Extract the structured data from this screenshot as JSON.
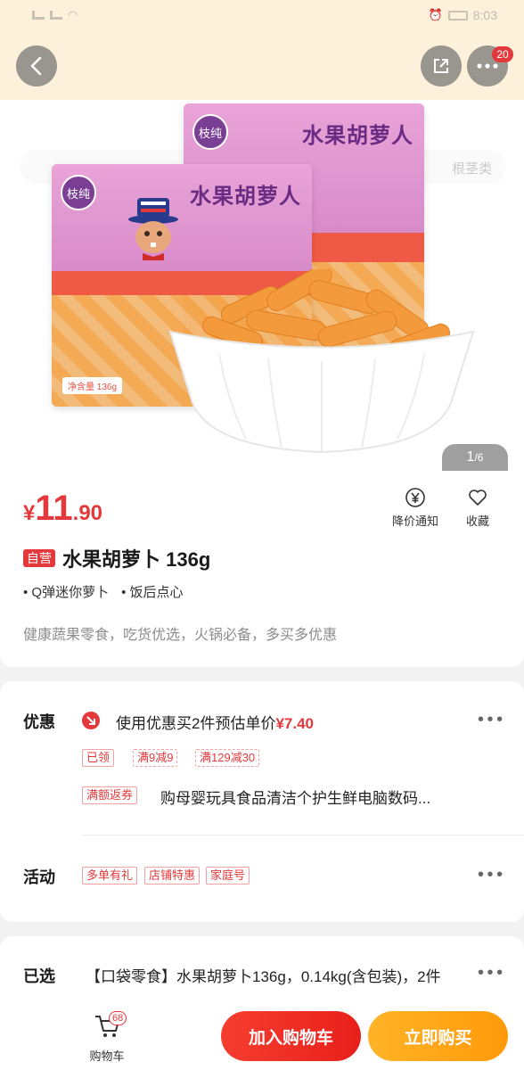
{
  "status_bar": {
    "time": "8:03"
  },
  "header": {
    "cart_badge": "20"
  },
  "gallery": {
    "current": "1",
    "total": "/6",
    "search_hint": "根茎类"
  },
  "product_image": {
    "brand": "枝纯",
    "package_title": "水果胡萝人",
    "net_weight": "净含量 136g"
  },
  "price": {
    "currency": "¥",
    "integer": "11",
    "decimal": ".90"
  },
  "actions": {
    "price_alert": "降价通知",
    "favorite": "收藏"
  },
  "product": {
    "badge": "自营",
    "title": "水果胡萝卜 136g",
    "tags": [
      "• Q弹迷你萝卜",
      "• 饭后点心"
    ],
    "subtitle": "健康蔬果零食，吃货优选，火锅必备，多买多优惠"
  },
  "promo": {
    "label": "优惠",
    "coupon_prefix": "使用优惠买2件预估单价",
    "coupon_price": "¥7.40",
    "chips": [
      "已领",
      "满9减9",
      "满129减30"
    ],
    "rebate_chip": "满额返券",
    "rebate_text": "购母婴玩具食品清洁个护生鲜电脑数码..."
  },
  "activity": {
    "label": "活动",
    "chips": [
      "多单有礼",
      "店铺特惠",
      "家庭号"
    ]
  },
  "selected": {
    "label": "已选",
    "text": "【口袋零食】水果胡萝卜136g，0.14kg(含包装)，2件"
  },
  "bottom_bar": {
    "cart_label": "购物车",
    "cart_count": "68",
    "add_to_cart": "加入购物车",
    "buy_now": "立即购买"
  },
  "colors": {
    "accent": "#e4393c",
    "buy": "#ffa615",
    "header_bg": "#fdf1dc"
  }
}
